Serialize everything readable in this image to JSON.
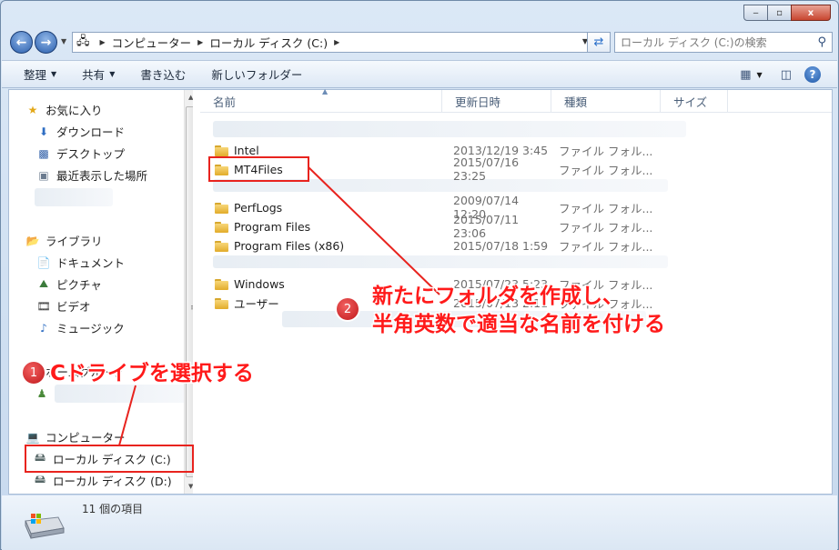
{
  "window": {
    "caption_buttons": [
      "‒",
      "▫",
      "x"
    ]
  },
  "address": {
    "crumbs": [
      "コンピューター",
      "ローカル ディスク (C:)"
    ],
    "search_placeholder": "ローカル ディスク (C:)の検索"
  },
  "toolbar": {
    "organize": "整理",
    "share": "共有",
    "burn": "書き込む",
    "new_folder": "新しいフォルダー"
  },
  "sidebar": {
    "favorites": "お気に入り",
    "downloads": "ダウンロード",
    "desktop": "デスクトップ",
    "recent": "最近表示した場所",
    "libraries": "ライブラリ",
    "documents": "ドキュメント",
    "pictures": "ピクチャ",
    "videos": "ビデオ",
    "music": "ミュージック",
    "homegroup": "ホームグループ",
    "computer": "コンピューター",
    "drive_c": "ローカル ディスク (C:)",
    "drive_d": "ローカル ディスク (D:)"
  },
  "columns": {
    "name": "名前",
    "date": "更新日時",
    "type": "種類",
    "size": "サイズ"
  },
  "files": [
    {
      "name": "Intel",
      "date": "2013/12/19 3:45",
      "type": "ファイル フォル..."
    },
    {
      "name": "MT4Files",
      "date": "2015/07/16 23:25",
      "type": "ファイル フォル..."
    },
    {
      "name": "PerfLogs",
      "date": "2009/07/14 12:20",
      "type": "ファイル フォル..."
    },
    {
      "name": "Program Files",
      "date": "2015/07/11 23:06",
      "type": "ファイル フォル..."
    },
    {
      "name": "Program Files (x86)",
      "date": "2015/07/18 1:59",
      "type": "ファイル フォル..."
    },
    {
      "name": "Windows",
      "date": "2015/07/23 5:23",
      "type": "ファイル フォル..."
    },
    {
      "name": "ユーザー",
      "date": "2015/07/13 2:11",
      "type": "ファイル フォル..."
    }
  ],
  "status": {
    "item_count": "11 個の項目"
  },
  "annotations": {
    "badge1": "1",
    "note1": "Cドライブを選択する",
    "badge2": "2",
    "note2_line1": "新たにフォルダを作成し、",
    "note2_line2": "半角英数で適当な名前を付ける",
    "color": "#e8231e"
  }
}
